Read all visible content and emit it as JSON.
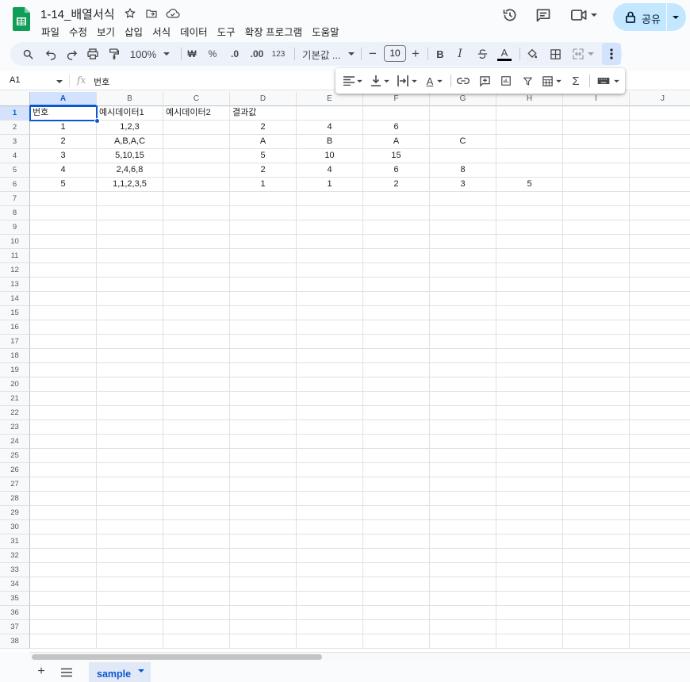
{
  "doc": {
    "title": "1-14_배열서식"
  },
  "menu": [
    "파일",
    "수정",
    "보기",
    "삽입",
    "서식",
    "데이터",
    "도구",
    "확장 프로그램",
    "도움말"
  ],
  "header": {
    "share_label": "공유"
  },
  "toolbar": {
    "zoom": "100%",
    "currency": "₩",
    "percent": "%",
    "decrease_decimal": ".0",
    "increase_decimal": ".00",
    "number_format": "123",
    "font": "기본값 ...",
    "font_size": "10",
    "minus": "−",
    "plus": "+"
  },
  "formula_bar": {
    "cell_ref": "A1",
    "fx": "fx",
    "content": "번호"
  },
  "columns": [
    "A",
    "B",
    "C",
    "D",
    "E",
    "F",
    "G",
    "H",
    "I",
    "J"
  ],
  "selected_cell": "A1",
  "rows": [
    [
      "번호",
      "예시데이터1",
      "예시데이터2",
      "결과값",
      "",
      "",
      "",
      "",
      "",
      ""
    ],
    [
      "1",
      "1,2,3",
      "",
      "2",
      "4",
      "6",
      "",
      "",
      "",
      ""
    ],
    [
      "2",
      "A,B,A,C",
      "",
      "A",
      "B",
      "A",
      "C",
      "",
      "",
      ""
    ],
    [
      "3",
      "5,10,15",
      "",
      "5",
      "10",
      "15",
      "",
      "",
      "",
      ""
    ],
    [
      "4",
      "2,4,6,8",
      "",
      "2",
      "4",
      "6",
      "8",
      "",
      "",
      ""
    ],
    [
      "5",
      "1,1,2,3,5",
      "",
      "1",
      "1",
      "2",
      "3",
      "5",
      "",
      ""
    ]
  ],
  "total_rows": 38,
  "sheet_tab": {
    "name": "sample"
  }
}
